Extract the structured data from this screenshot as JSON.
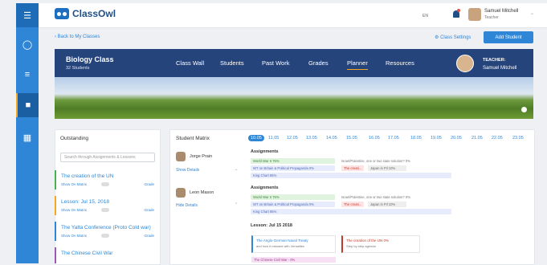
{
  "app": {
    "brand": "ClassOwl"
  },
  "topbar": {
    "language": "EN",
    "user_name": "Samuel Mitchell",
    "user_role": "Teacher"
  },
  "nav": {
    "back": "Back to My Classes",
    "settings": "Class Settings",
    "add_student": "Add Student"
  },
  "class": {
    "name": "Biology Class",
    "students": "32 Students",
    "tabs": [
      "Class Wall",
      "Students",
      "Past Work",
      "Grades",
      "Planner",
      "Resources"
    ],
    "active_tab": "Planner",
    "teacher_label": "TEACHER:",
    "teacher_name": "Samuel Mitchell"
  },
  "outstanding": {
    "title": "Outstanding",
    "search_placeholder": "Search through Assignments & Lessons",
    "items": [
      {
        "title": "The creation of the UN",
        "show": "Show On Matrix",
        "grade": "Grade",
        "color": "#4caf50"
      },
      {
        "title": "Lesson: Jul 15, 2018",
        "show": "Show On Matrix",
        "grade": "Grade",
        "color": "#f5a623"
      },
      {
        "title": "The Yalta Conference (Proto Cold war)",
        "show": "Show On Matrix",
        "grade": "Grade",
        "color": "#2f86d6"
      },
      {
        "title": "The Chinese Civil War",
        "show": "",
        "grade": "",
        "color": "#9b59b6"
      }
    ]
  },
  "matrix": {
    "title": "Student Matrix",
    "dates": [
      "10.05",
      "11.05",
      "12.05",
      "13.05",
      "14.05",
      "15.05",
      "16.05",
      "17.05",
      "18.05",
      "19.05",
      "20.05",
      "21.05",
      "22.05",
      "23.05"
    ],
    "active_date": "10.05",
    "students": [
      {
        "name": "Jorge Prain",
        "details": "Show Details"
      },
      {
        "name": "Leon Mason",
        "details": "Hide Details"
      }
    ],
    "assignments_label": "Assignments",
    "rows": [
      {
        "a": "World War II 75%",
        "b": "WT on Britain & Political Propaganda 0%",
        "c": "King Chart 85%",
        "d": "Israel/Palestine, one or two state solution? 0%",
        "e": "The creati...",
        "f": "Japan in Ftl 10%"
      },
      {
        "a": "World War II 75%",
        "b": "WT on Britain & Political Propaganda 0%",
        "c": "King Chart 85%",
        "d": "Israel/Palestine, one or two state solution? 0%",
        "e": "The creati...",
        "f": "Japan in Ftl 10%"
      }
    ],
    "lesson_label": "Lesson: Jul 15 2018",
    "cards": [
      {
        "title": "The Anglo-German Naval Treaty",
        "sub": "and how it messed with Versailles",
        "color": "#2f86d6"
      },
      {
        "title": "The creation of the UN 0%",
        "sub": "Step by step agenda",
        "color": "#c0392b"
      }
    ],
    "bottom_chip": "The Chinese Civil War - 0%"
  }
}
